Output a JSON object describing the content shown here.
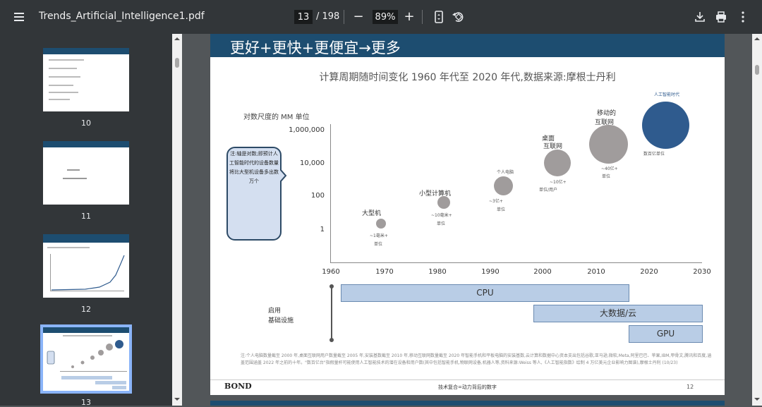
{
  "toolbar": {
    "title": "Trends_Artificial_Intelligence1.pdf",
    "current_page": "13",
    "total_pages": "/ 198",
    "zoom": "89%",
    "zoom_out": "−",
    "zoom_in": "+"
  },
  "sidebar": {
    "thumbnails": [
      {
        "num": "10"
      },
      {
        "num": "11"
      },
      {
        "num": "12"
      },
      {
        "num": "13"
      }
    ]
  },
  "slide": {
    "title": "更好+更快+更便宜→更多",
    "chart_title": "计算周期随时间变化   1960 年代至 2020 年代,数据来源:摩根士丹利",
    "note": "注:轴是对数;即预计人工智能时代的设备数量将比大型机设备多出数万个",
    "infra_label_1": "启用",
    "infra_label_2": "基础设施",
    "footnote": "注:个人电脑数量截至 2000 年,桌面互联网用户数量截至 2005 年,安装基数截至 2010 年,移动互联网数量截至 2020 年智能手机和平板电脑的安装基数,云计算和数据中心资本支出包括谷歌,亚马逊,微软,Meta,阿里巴巴、苹果,IBM,甲骨文,腾讯和百度,涵盖范围涵盖 2022 年之前的十年。\"数百亿台\"指假量杆可能使用人工智能技术的潜在设备和用户数(其中包括智能手机,物联网设备,机器人等,资料来源:Weiss 等人,《人工智能指数》绘制 4 万亿美元企业影响力图谱),摩根士丹利 (10/23)",
    "brand": "BOND",
    "footer_center": "技术复合=动力背后的数字",
    "page_num": "12"
  },
  "chart_data": {
    "type": "scatter",
    "title": "计算周期随时间变化   1960 年代至 2020 年代,数据来源:摩根士丹利",
    "ylabel": "对数尺度的 MM 单位",
    "y_scale": "log",
    "y_ticks": [
      "1,000,000",
      "10,000",
      "100",
      "1"
    ],
    "x_ticks": [
      "1960",
      "1970",
      "1980",
      "1990",
      "2000",
      "2010",
      "2020",
      "2030"
    ],
    "xlim": [
      1960,
      2030
    ],
    "ylim": [
      0.1,
      1000000
    ],
    "points": [
      {
        "x": 1967,
        "y": 1,
        "label": "大型机",
        "sub1": "~1毫米+",
        "sub2": "单位",
        "color": "#a09c9c"
      },
      {
        "x": 1981,
        "y": 10,
        "label": "小型计算机",
        "sub1": "~10毫米+",
        "sub2": "单位",
        "color": "#a09c9c"
      },
      {
        "x": 1992,
        "y": 300,
        "label": "个人电脑",
        "sub1": "~3亿+",
        "sub2": "单位",
        "color": "#a09c9c"
      },
      {
        "x": 2003,
        "y": 1000,
        "label": "桌面",
        "label2": "互联网",
        "sub1": "~10亿+",
        "sub2": "单位/用户",
        "color": "#a09c9c"
      },
      {
        "x": 2012,
        "y": 10000,
        "label": "移动的",
        "label2": "互联网",
        "sub1": "~40亿+",
        "sub2": "单位",
        "color": "#a09c9c"
      },
      {
        "x": 2024,
        "y": 100000,
        "label": "人工智能时代",
        "sub1": "数百亿单位",
        "color": "#2f5b8e"
      }
    ],
    "bars": [
      {
        "name": "CPU",
        "start": 1962,
        "end": 2016
      },
      {
        "name": "大数据/云",
        "start": 1998,
        "end": 2030
      },
      {
        "name": "GPU",
        "start": 2016,
        "end": 2030
      }
    ]
  }
}
